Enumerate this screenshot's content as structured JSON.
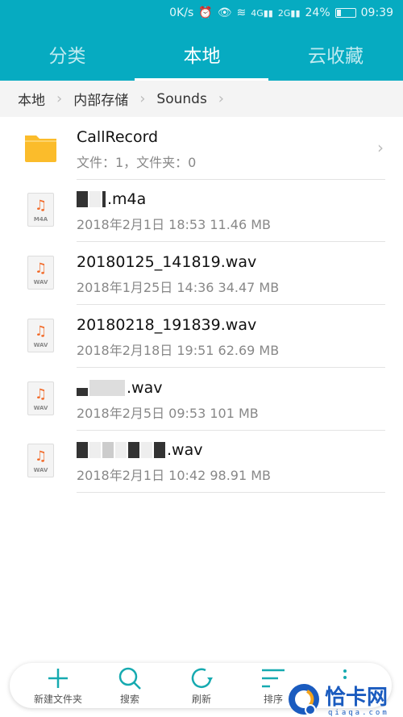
{
  "status_bar": {
    "speed": "0K/s",
    "battery": "24%",
    "time": "09:39",
    "battery_level": 0.24
  },
  "tabs": [
    {
      "label": "分类"
    },
    {
      "label": "本地",
      "active": true
    },
    {
      "label": "云收藏"
    }
  ],
  "breadcrumb": [
    "本地",
    "内部存储",
    "Sounds"
  ],
  "items": [
    {
      "type": "folder",
      "name": "CallRecord",
      "meta": "文件：1，文件夹：0"
    },
    {
      "type": "file",
      "icon": "M4A",
      "name": ".m4a",
      "meta": "2018年2月1日 18:53 11.46 MB"
    },
    {
      "type": "file",
      "icon": "WAV",
      "name": "20180125_141819.wav",
      "meta": "2018年1月25日 14:36 34.47 MB"
    },
    {
      "type": "file",
      "icon": "WAV",
      "name": "20180218_191839.wav",
      "meta": "2018年2月18日 19:51 62.69 MB"
    },
    {
      "type": "file",
      "icon": "WAV",
      "name": ".wav",
      "meta": "2018年2月5日 09:53 101 MB"
    },
    {
      "type": "file",
      "icon": "WAV",
      "name": ".wav",
      "meta": "2018年2月1日 10:42 98.91 MB"
    }
  ],
  "toolbar": {
    "new_folder": "新建文件夹",
    "search": "搜索",
    "refresh": "刷新",
    "sort": "排序"
  },
  "watermark": {
    "text": "恰卡网",
    "domain": "qiaqa.com"
  },
  "colors": {
    "accent": "#06abc1",
    "folder": "#fbbc2b",
    "music": "#f26b2a"
  }
}
